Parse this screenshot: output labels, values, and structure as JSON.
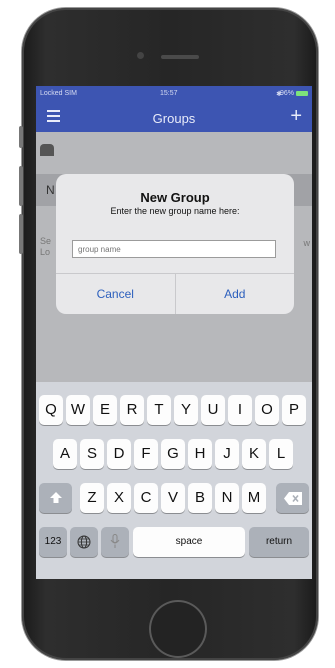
{
  "status_bar": {
    "carrier": "Locked SIM",
    "time": "15:57",
    "battery": "96%"
  },
  "nav": {
    "title": "Groups",
    "menu_icon": "hamburger-menu-icon",
    "add_icon": "plus-icon",
    "add_label": "+"
  },
  "background": {
    "row_initial": "N",
    "text_line1": "Se",
    "text_line2": "Lo",
    "text_right": "w"
  },
  "dialog": {
    "title": "New Group",
    "message": "Enter the new group name here:",
    "input_placeholder": "group name",
    "input_value": "",
    "cancel_label": "Cancel",
    "add_label": "Add"
  },
  "keyboard": {
    "row1": [
      "Q",
      "W",
      "E",
      "R",
      "T",
      "Y",
      "U",
      "I",
      "O",
      "P"
    ],
    "row2": [
      "A",
      "S",
      "D",
      "F",
      "G",
      "H",
      "J",
      "K",
      "L"
    ],
    "row3": [
      "Z",
      "X",
      "C",
      "V",
      "B",
      "N",
      "M"
    ],
    "shift_icon": "shift-arrow-icon",
    "delete_icon": "delete-backspace-icon",
    "globe_icon": "globe-icon",
    "mic_icon": "microphone-icon",
    "numbers_label": "123",
    "space_label": "space",
    "return_label": "return"
  },
  "colors": {
    "nav_bar": "#3d55b2",
    "dialog_button_text": "#2c5fbd"
  }
}
